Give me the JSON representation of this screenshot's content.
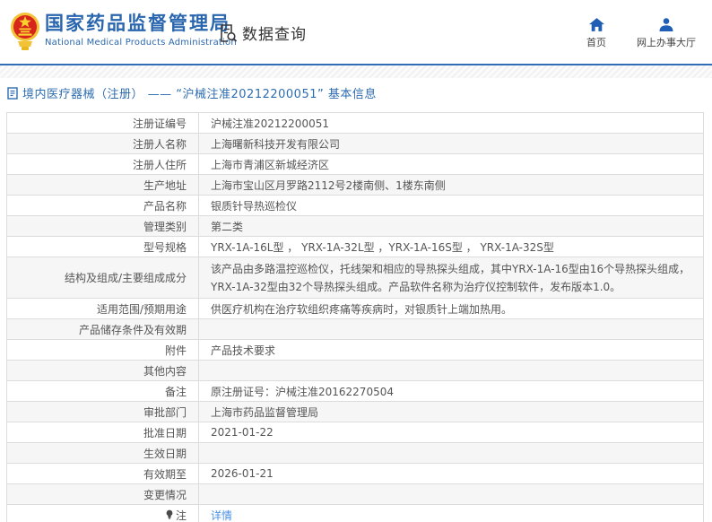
{
  "header": {
    "agency_name_cn": "国家药品监督管理局",
    "agency_name_en": "National Medical Products Administration",
    "data_query_label": "数据查询",
    "nav": [
      {
        "label": "首页",
        "icon": "home-icon"
      },
      {
        "label": "网上办事大厅",
        "icon": "user-icon"
      }
    ]
  },
  "page": {
    "title": "境内医疗器械（注册） —— “沪械注准20212200051” 基本信息"
  },
  "table": {
    "rows": [
      {
        "label": "注册证编号",
        "value": "沪械注准20212200051"
      },
      {
        "label": "注册人名称",
        "value": "上海曙新科技开发有限公司"
      },
      {
        "label": "注册人住所",
        "value": "上海市青浦区新城经济区"
      },
      {
        "label": "生产地址",
        "value": "上海市宝山区月罗路2112号2楼南侧、1楼东南侧"
      },
      {
        "label": "产品名称",
        "value": "银质针导热巡检仪"
      },
      {
        "label": "管理类别",
        "value": "第二类"
      },
      {
        "label": "型号规格",
        "value": "YRX-1A-16L型 ， YRX-1A-32L型 ，YRX-1A-16S型 ， YRX-1A-32S型"
      },
      {
        "label": "结构及组成/主要组成成分",
        "value": "该产品由多路温控巡检仪，托线架和相应的导热探头组成，其中YRX-1A-16型由16个导热探头组成，YRX-1A-32型由32个导热探头组成。产品软件名称为治疗仪控制软件，发布版本1.0。",
        "tall": true
      },
      {
        "label": "适用范围/预期用途",
        "value": "供医疗机构在治疗软组织疼痛等疾病时，对银质针上端加热用。"
      },
      {
        "label": "产品储存条件及有效期",
        "value": ""
      },
      {
        "label": "附件",
        "value": "产品技术要求"
      },
      {
        "label": "其他内容",
        "value": ""
      },
      {
        "label": "备注",
        "value": "原注册证号：沪械注准20162270504"
      },
      {
        "label": "审批部门",
        "value": "上海市药品监督管理局"
      },
      {
        "label": "批准日期",
        "value": "2021-01-22"
      },
      {
        "label": "生效日期",
        "value": ""
      },
      {
        "label": "有效期至",
        "value": "2026-01-21"
      },
      {
        "label": "变更情况",
        "value": ""
      },
      {
        "label": "注",
        "value": "详情",
        "link": true,
        "label_icon": "lightbulb-icon"
      }
    ]
  },
  "colors": {
    "brand_blue": "#2a66ae",
    "accent_line": "#2f6db8",
    "link_blue": "#4a8fe2",
    "emblem_red": "#d8251c",
    "emblem_gold": "#f3c337"
  }
}
